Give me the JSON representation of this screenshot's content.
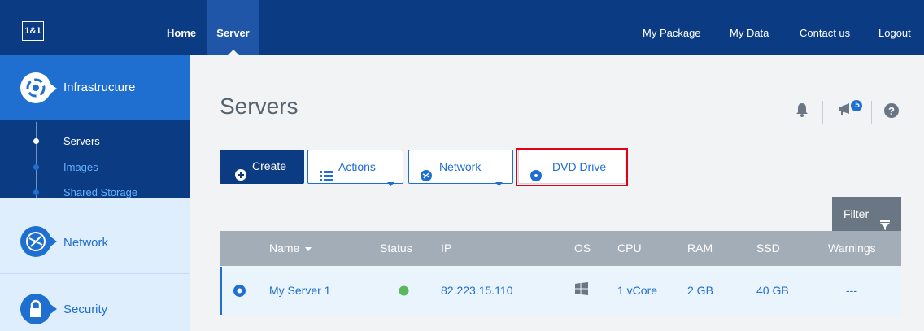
{
  "topbar": {
    "logo": "1&1",
    "nav_left": [
      "Home",
      "Server"
    ],
    "nav_right": [
      "My Package",
      "My Data",
      "Contact us",
      "Logout"
    ]
  },
  "sidebar": {
    "infrastructure": "Infrastructure",
    "sub_items": [
      "Servers",
      "Images",
      "Shared Storage"
    ],
    "network": "Network",
    "security": "Security"
  },
  "main": {
    "title": "Servers",
    "notification_count": "5"
  },
  "toolbar": {
    "create": "Create",
    "actions": "Actions",
    "network": "Network",
    "dvd": "DVD Drive",
    "filter": "Filter"
  },
  "table": {
    "columns": [
      "Name",
      "Status",
      "IP",
      "OS",
      "CPU",
      "RAM",
      "SSD",
      "Warnings"
    ],
    "rows": [
      {
        "name": "My Server 1",
        "ip": "82.223.15.110",
        "cpu": "1 vCore",
        "ram": "2 GB",
        "ssd": "40 GB",
        "warnings": "---",
        "status_color": "#5cb85c"
      }
    ]
  },
  "colors": {
    "brand_dark": "#0b3b82",
    "brand_blue": "#1f6fd1",
    "highlight": "#e3001b"
  }
}
